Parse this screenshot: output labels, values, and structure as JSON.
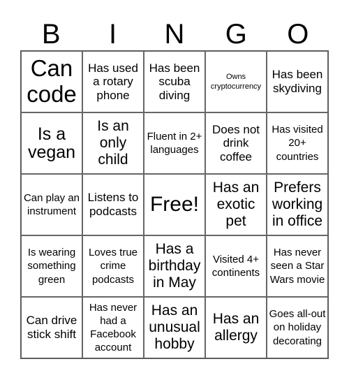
{
  "header": {
    "letters": [
      "B",
      "I",
      "N",
      "G",
      "O"
    ]
  },
  "grid": {
    "cells": [
      {
        "text": "Can code",
        "size": "xl"
      },
      {
        "text": "Has used a rotary phone",
        "size": "m"
      },
      {
        "text": "Has been scuba diving",
        "size": "m"
      },
      {
        "text": "Owns cryptocurrency",
        "size": "xs"
      },
      {
        "text": "Has been skydiving",
        "size": "m"
      },
      {
        "text": "Is a vegan",
        "size": "l"
      },
      {
        "text": "Is an only child",
        "size": "ml"
      },
      {
        "text": "Fluent in 2+ languages",
        "size": "s"
      },
      {
        "text": "Does not drink coffee",
        "size": "m"
      },
      {
        "text": "Has visited 20+ countries",
        "size": "s"
      },
      {
        "text": "Can play an instrument",
        "size": "s"
      },
      {
        "text": "Listens to podcasts",
        "size": "m"
      },
      {
        "text": "Free!",
        "size": "free"
      },
      {
        "text": "Has an exotic pet",
        "size": "ml"
      },
      {
        "text": "Prefers working in office",
        "size": "ml"
      },
      {
        "text": "Is wearing something green",
        "size": "s"
      },
      {
        "text": "Loves true crime podcasts",
        "size": "s"
      },
      {
        "text": "Has a birthday in May",
        "size": "ml"
      },
      {
        "text": "Visited 4+ continents",
        "size": "s"
      },
      {
        "text": "Has never seen a Star Wars movie",
        "size": "s"
      },
      {
        "text": "Can drive stick shift",
        "size": "m"
      },
      {
        "text": "Has never had a Facebook account",
        "size": "s"
      },
      {
        "text": "Has an unusual hobby",
        "size": "ml"
      },
      {
        "text": "Has an allergy",
        "size": "ml"
      },
      {
        "text": "Goes all-out on holiday decorating",
        "size": "s"
      }
    ]
  }
}
